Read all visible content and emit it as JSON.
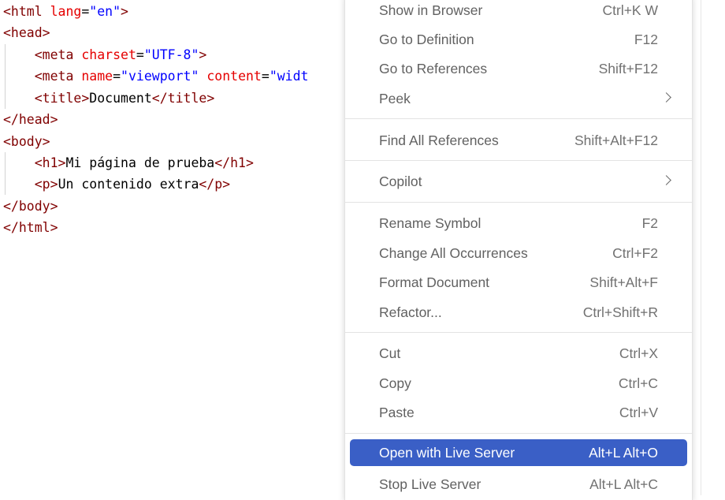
{
  "editor": {
    "lines": [
      {
        "tokens": [
          {
            "t": "tag",
            "v": "<html "
          },
          {
            "t": "attr",
            "v": "lang"
          },
          {
            "t": "txt",
            "v": "="
          },
          {
            "t": "val",
            "v": "\"en\""
          },
          {
            "t": "tag",
            "v": ">"
          }
        ]
      },
      {
        "tokens": [
          {
            "t": "tag",
            "v": "<head>"
          }
        ]
      },
      {
        "tokens": [
          {
            "t": "txt",
            "v": "    "
          },
          {
            "t": "tag",
            "v": "<meta "
          },
          {
            "t": "attr",
            "v": "charset"
          },
          {
            "t": "txt",
            "v": "="
          },
          {
            "t": "val",
            "v": "\"UTF-8\""
          },
          {
            "t": "tag",
            "v": ">"
          }
        ]
      },
      {
        "tokens": [
          {
            "t": "txt",
            "v": "    "
          },
          {
            "t": "tag",
            "v": "<meta "
          },
          {
            "t": "attr",
            "v": "name"
          },
          {
            "t": "txt",
            "v": "="
          },
          {
            "t": "val",
            "v": "\"viewport\""
          },
          {
            "t": "txt",
            "v": " "
          },
          {
            "t": "attr",
            "v": "content"
          },
          {
            "t": "txt",
            "v": "="
          },
          {
            "t": "val",
            "v": "\"widt"
          }
        ]
      },
      {
        "tokens": [
          {
            "t": "txt",
            "v": "    "
          },
          {
            "t": "tag",
            "v": "<title>"
          },
          {
            "t": "txt",
            "v": "Document"
          },
          {
            "t": "tag",
            "v": "</title>"
          }
        ]
      },
      {
        "tokens": [
          {
            "t": "tag",
            "v": "</head>"
          }
        ]
      },
      {
        "tokens": [
          {
            "t": "tag",
            "v": "<body>"
          }
        ]
      },
      {
        "tokens": [
          {
            "t": "txt",
            "v": "    "
          },
          {
            "t": "tag",
            "v": "<h1>"
          },
          {
            "t": "txt",
            "v": "Mi página de prueba"
          },
          {
            "t": "tag",
            "v": "</h1>"
          }
        ]
      },
      {
        "tokens": [
          {
            "t": "txt",
            "v": "    "
          },
          {
            "t": "tag",
            "v": "<p>"
          },
          {
            "t": "txt",
            "v": "Un contenido extra"
          },
          {
            "t": "tag",
            "v": "</p>"
          }
        ]
      },
      {
        "tokens": [
          {
            "t": "tag",
            "v": "</body>"
          }
        ]
      },
      {
        "tokens": [
          {
            "t": "tag",
            "v": "</html>"
          }
        ]
      }
    ]
  },
  "menu": {
    "items": [
      {
        "id": "show-in-browser",
        "label": "Show in Browser",
        "key": "Ctrl+K W"
      },
      {
        "id": "go-to-definition",
        "label": "Go to Definition",
        "key": "F12"
      },
      {
        "id": "go-to-references",
        "label": "Go to References",
        "key": "Shift+F12"
      },
      {
        "id": "peek",
        "label": "Peek",
        "key": ""
      },
      {
        "id": "find-all-references",
        "label": "Find All References",
        "key": "Shift+Alt+F12"
      },
      {
        "id": "copilot",
        "label": "Copilot",
        "key": ""
      },
      {
        "id": "rename-symbol",
        "label": "Rename Symbol",
        "key": "F2"
      },
      {
        "id": "change-all-occurrences",
        "label": "Change All Occurrences",
        "key": "Ctrl+F2"
      },
      {
        "id": "format-document",
        "label": "Format Document",
        "key": "Shift+Alt+F"
      },
      {
        "id": "refactor",
        "label": "Refactor...",
        "key": "Ctrl+Shift+R"
      },
      {
        "id": "cut",
        "label": "Cut",
        "key": "Ctrl+X"
      },
      {
        "id": "copy",
        "label": "Copy",
        "key": "Ctrl+C"
      },
      {
        "id": "paste",
        "label": "Paste",
        "key": "Ctrl+V"
      },
      {
        "id": "open-with-live-server",
        "label": "Open with Live Server",
        "key": "Alt+L Alt+O"
      },
      {
        "id": "stop-live-server",
        "label": "Stop Live Server",
        "key": "Alt+L Alt+C"
      }
    ],
    "selected_label": "Open with Live Server",
    "colors": {
      "selected_bg": "#3a5fc6",
      "tag": "#800000",
      "attribute": "#e50000",
      "value": "#0000ff"
    }
  }
}
